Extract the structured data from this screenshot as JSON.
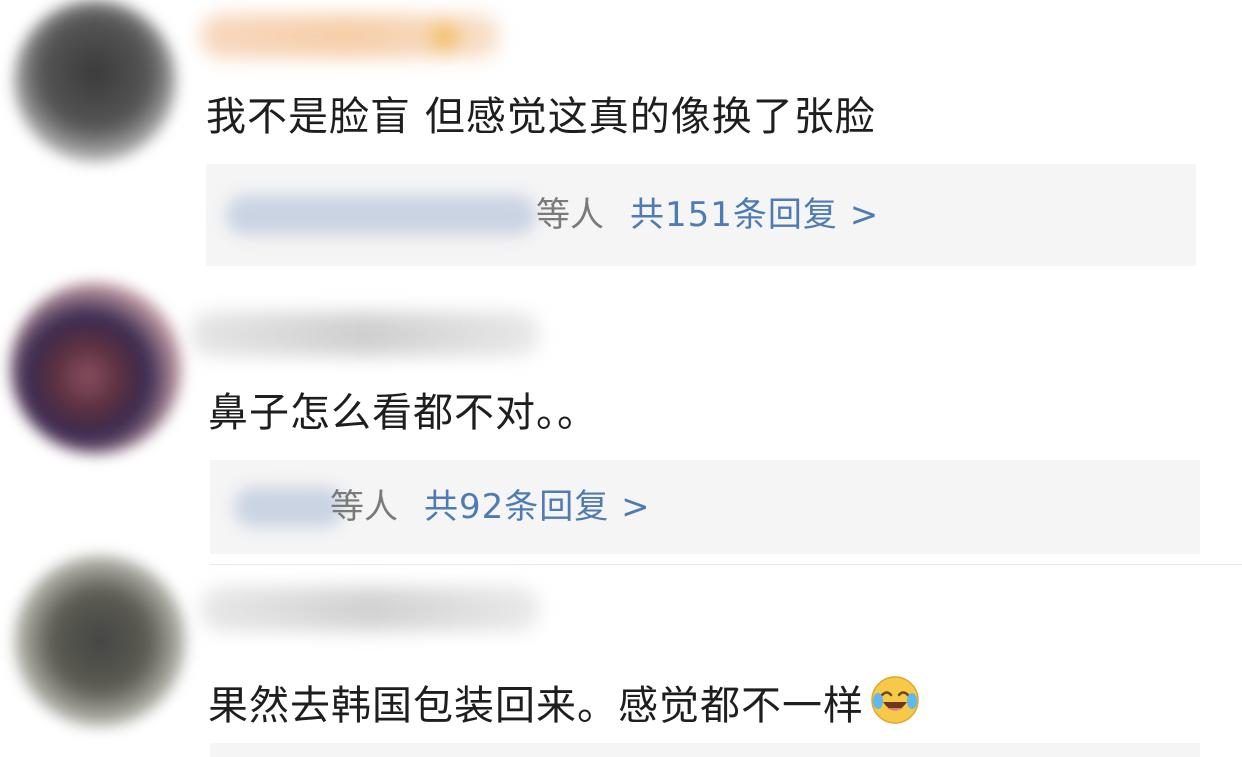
{
  "comments": [
    {
      "text": "我不是脸盲  但感觉这真的像换了张脸",
      "reply_suffix": "等人",
      "reply_count": "共151条回复 >"
    },
    {
      "text": "鼻子怎么看都不对。。",
      "reply_suffix": "等人",
      "reply_count": "共92条回复 >"
    },
    {
      "text": "果然去韩国包装回来。感觉都不一样",
      "emoji": "laughing-crying-emoji"
    }
  ],
  "colors": {
    "reply_link": "#4e7cb2",
    "reply_box_bg": "#f5f5f5",
    "text": "#1e1e1e",
    "suffix": "#7a7a7a"
  }
}
